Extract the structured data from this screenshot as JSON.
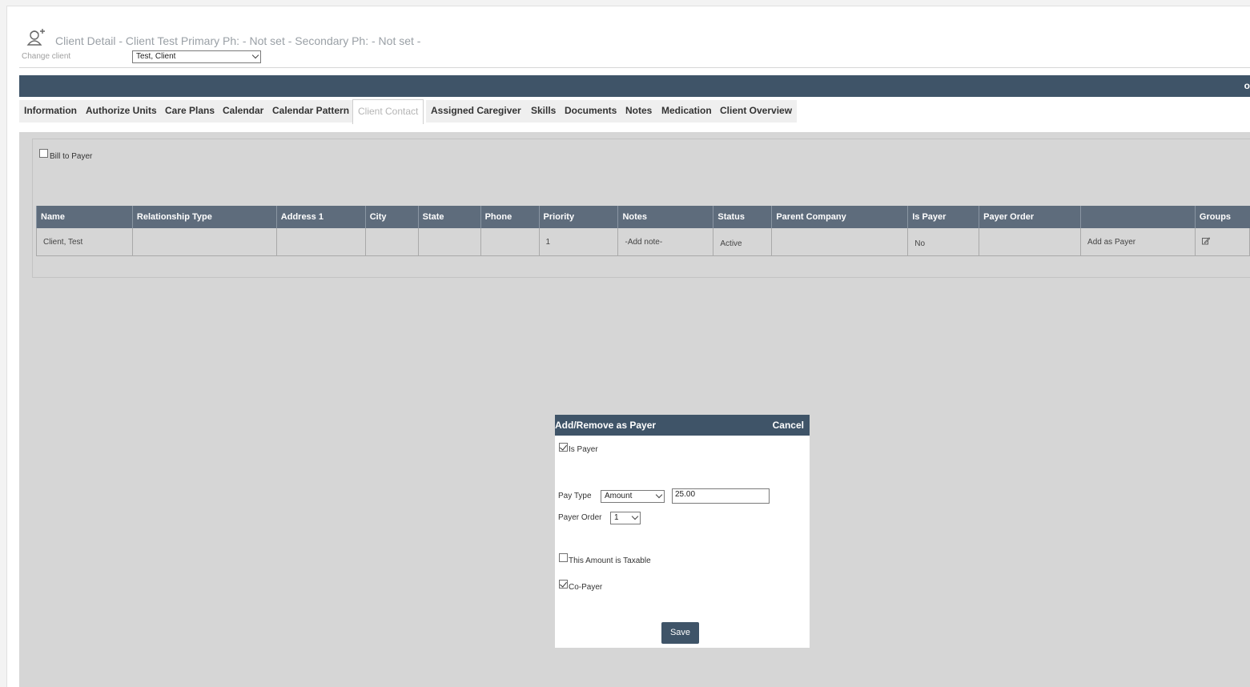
{
  "header": {
    "title": "Client Detail - Client Test Primary Ph: - Not set - Secondary Ph: - Not set -",
    "change_client_label": "Change client",
    "client_select_value": "Test, Client",
    "icon": "client-add-icon"
  },
  "navbar": {
    "trailing_text": "o"
  },
  "tabs": [
    {
      "label": "Information"
    },
    {
      "label": "Authorize Units"
    },
    {
      "label": "Care Plans"
    },
    {
      "label": "Calendar"
    },
    {
      "label": "Calendar Pattern"
    },
    {
      "label": "Client Contact"
    },
    {
      "label": "Assigned Caregiver"
    },
    {
      "label": "Skills"
    },
    {
      "label": "Documents"
    },
    {
      "label": "Notes"
    },
    {
      "label": "Medication"
    },
    {
      "label": "Client Overview"
    }
  ],
  "active_tab": "Client Contact",
  "bill_to_payer": {
    "label": "Bill to Payer",
    "checked": false
  },
  "contacts_table": {
    "columns": [
      "Name",
      "Relationship Type",
      "Address 1",
      "City",
      "State",
      "Phone",
      "Priority",
      "Notes",
      "Status",
      "Parent Company",
      "Is Payer",
      "Payer Order",
      "",
      "Groups"
    ],
    "rows": [
      {
        "name": "Client, Test",
        "relationship_type": "",
        "address1": "",
        "city": "",
        "state": "",
        "phone": "",
        "priority": "1",
        "notes": "-Add note-",
        "status": "Active",
        "parent_company": "",
        "is_payer": "No",
        "payer_order": "",
        "action": "Add as Payer",
        "groups_icon": "edit-icon"
      }
    ]
  },
  "modal": {
    "title": "Add/Remove as Payer",
    "cancel_label": "Cancel",
    "is_payer": {
      "label": "Is Payer",
      "checked": true
    },
    "pay_type": {
      "label": "Pay Type",
      "value": "Amount",
      "amount": "25.00"
    },
    "payer_order": {
      "label": "Payer Order",
      "value": "1"
    },
    "taxable": {
      "label": "This Amount is Taxable",
      "checked": false
    },
    "co_payer": {
      "label": "Co-Payer",
      "checked": true
    },
    "save_label": "Save"
  },
  "colors": {
    "navbar": "#3f5468",
    "table_header": "#5e6c7c",
    "content_bg": "#d6d6d6"
  }
}
